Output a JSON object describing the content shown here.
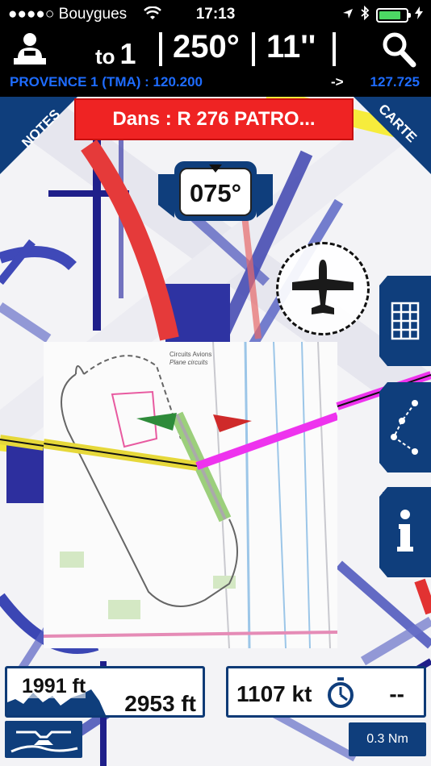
{
  "status_bar": {
    "carrier": "●●●●○ Bouygues",
    "time": "17:13",
    "battery_level": 0.8
  },
  "nav": {
    "to_label": "to",
    "waypoint": "1",
    "heading": "250°",
    "time_to": "11''",
    "frequency_left": "PROVENCE 1 (TMA) : 120.200",
    "frequency_arrow": "->",
    "frequency_right": "127.725"
  },
  "map": {
    "notes_label": "NOTES",
    "carte_label": "CARTE",
    "alert": "Dans : R 276 PATRO...",
    "heading_bug": "075°",
    "chart_texts": {
      "circuits_title": "Circuits Avions",
      "circuits_sub": "Plane circuits"
    }
  },
  "instruments": {
    "altitude_1": "1991 ft",
    "altitude_2": "2953 ft",
    "ground_speed": "1107 kt",
    "timer_value": "--",
    "scale": "0.3 Nm"
  },
  "colors": {
    "accent_blue": "#0f3e7c",
    "alert_red": "#ef2323",
    "frequency_blue": "#1e6cff"
  },
  "icons": [
    "pilot-icon",
    "search-icon",
    "airplane-icon",
    "grid-icon",
    "route-icon",
    "info-icon",
    "stopwatch-icon",
    "vertical-profile-icon"
  ]
}
